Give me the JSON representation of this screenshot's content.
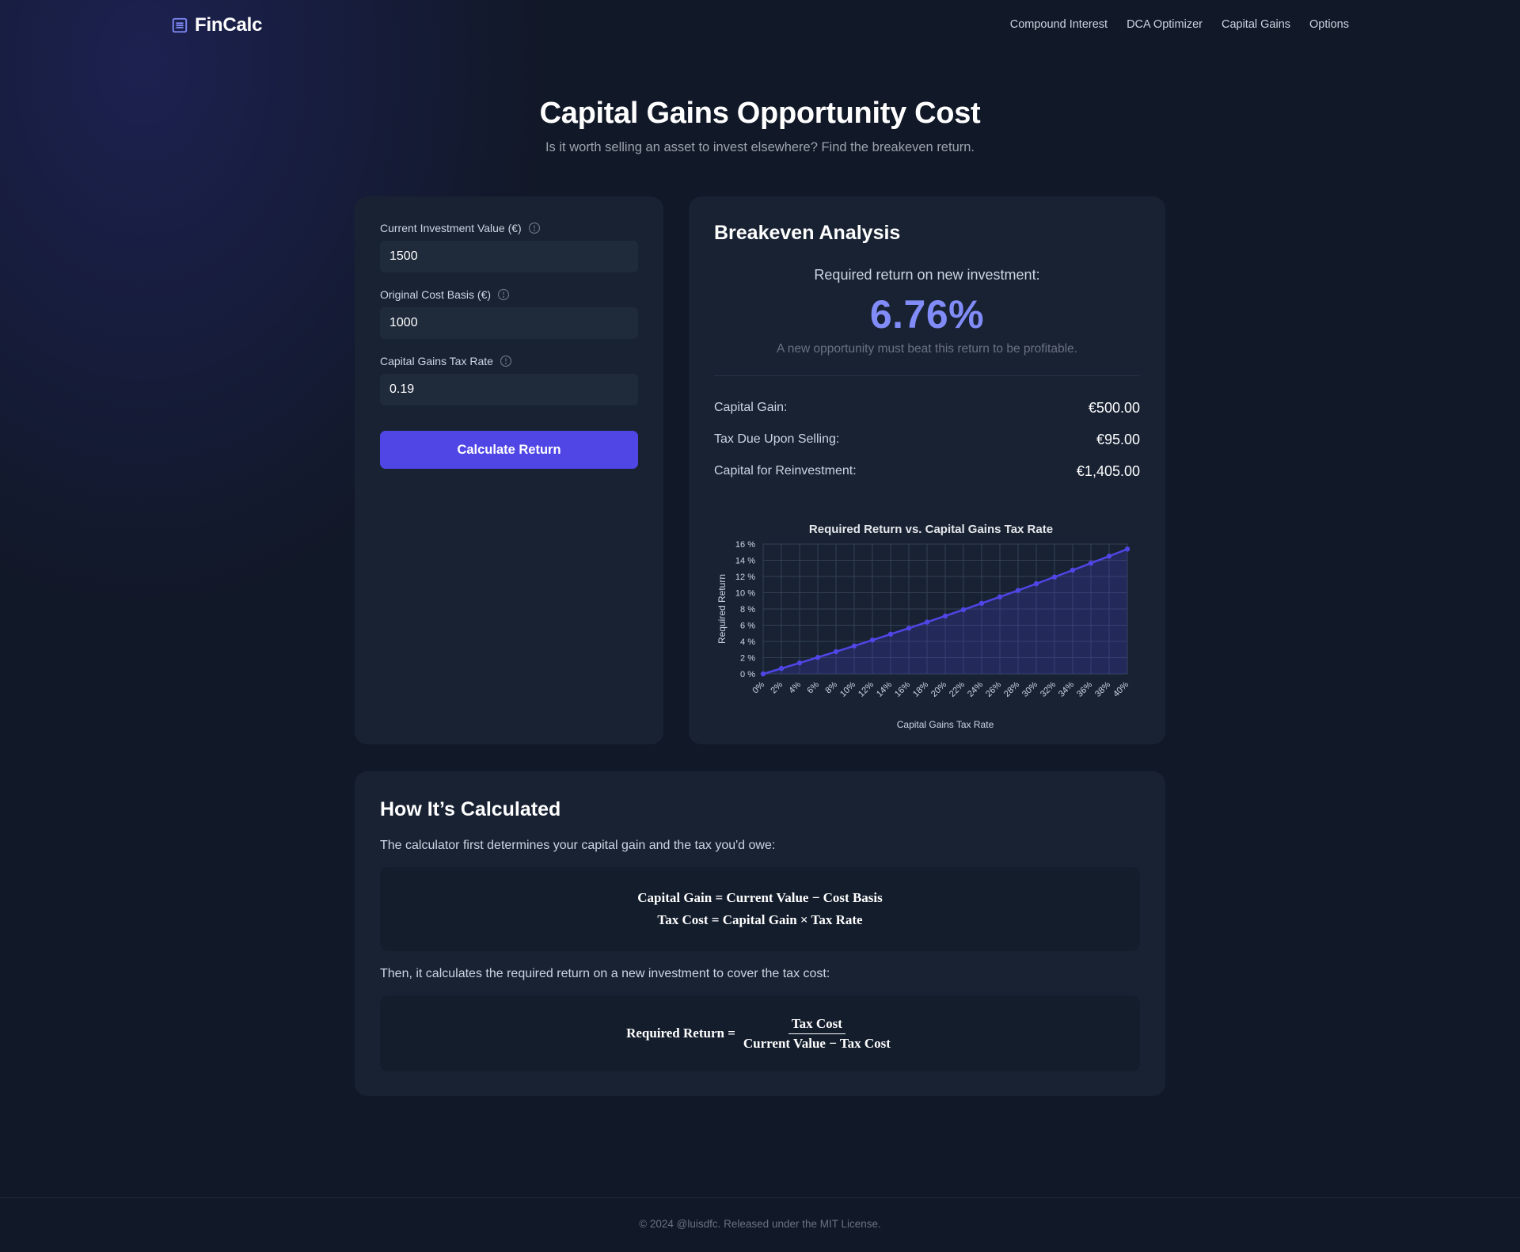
{
  "brand": {
    "name": "FinCalc",
    "icon": "list-icon"
  },
  "nav": {
    "links": [
      "Compound Interest",
      "DCA Optimizer",
      "Capital Gains",
      "Options"
    ]
  },
  "hero": {
    "title": "Capital Gains Opportunity Cost",
    "subtitle": "Is it worth selling an asset to invest elsewhere? Find the breakeven return."
  },
  "inputs": {
    "current_value": {
      "label": "Current Investment Value (€)",
      "value": "1500"
    },
    "cost_basis": {
      "label": "Original Cost Basis (€)",
      "value": "1000"
    },
    "tax_rate": {
      "label": "Capital Gains Tax Rate",
      "value": "0.19"
    },
    "button_label": "Calculate Return"
  },
  "results": {
    "title": "Breakeven Analysis",
    "required_label": "Required return on new investment:",
    "required_value": "6.76%",
    "note": "A new opportunity must beat this return to be profitable.",
    "stats": [
      {
        "label": "Capital Gain:",
        "value": "€500.00"
      },
      {
        "label": "Tax Due Upon Selling:",
        "value": "€95.00"
      },
      {
        "label": "Capital for Reinvestment:",
        "value": "€1,405.00"
      }
    ]
  },
  "colors": {
    "accent": "#4f46e5",
    "accent_light": "#818cf8",
    "card": "#182233",
    "background": "#111827"
  },
  "chart_data": {
    "type": "area",
    "title": "Required Return vs. Capital Gains Tax Rate",
    "xlabel": "Capital Gains Tax Rate",
    "ylabel": "Required Return",
    "x": [
      0,
      2,
      4,
      6,
      8,
      10,
      12,
      14,
      16,
      18,
      20,
      22,
      24,
      26,
      28,
      30,
      32,
      34,
      36,
      38,
      40
    ],
    "x_tick_labels": [
      "0%",
      "2%",
      "4%",
      "6%",
      "8%",
      "10%",
      "12%",
      "14%",
      "16%",
      "18%",
      "20%",
      "22%",
      "24%",
      "26%",
      "28%",
      "30%",
      "32%",
      "34%",
      "36%",
      "38%",
      "40%"
    ],
    "values": [
      0,
      0.67,
      1.35,
      2.04,
      2.74,
      3.45,
      4.17,
      4.9,
      5.63,
      6.38,
      7.14,
      7.91,
      8.7,
      9.49,
      10.29,
      11.11,
      11.94,
      12.78,
      13.64,
      14.5,
      15.38
    ],
    "y_tick_labels": [
      "0 %",
      "2 %",
      "4 %",
      "6 %",
      "8 %",
      "10 %",
      "12 %",
      "14 %",
      "16 %"
    ],
    "y_ticks": [
      0,
      2,
      4,
      6,
      8,
      10,
      12,
      14,
      16
    ],
    "ylim": [
      0,
      16
    ],
    "grid": true,
    "legend": "none"
  },
  "how": {
    "title": "How It’s Calculated",
    "intro": "The calculator first determines your capital gain and the tax you'd owe:",
    "formula1": "Capital Gain = Current Value − Cost Basis",
    "formula2": "Tax Cost = Capital Gain × Tax Rate",
    "intro2": "Then, it calculates the required return on a new investment to cover the tax cost:",
    "formula3_lhs": "Required Return =",
    "formula3_num": "Tax Cost",
    "formula3_den": "Current Value − Tax Cost"
  },
  "footer": {
    "text": "© 2024 @luisdfc. Released under the MIT License."
  }
}
